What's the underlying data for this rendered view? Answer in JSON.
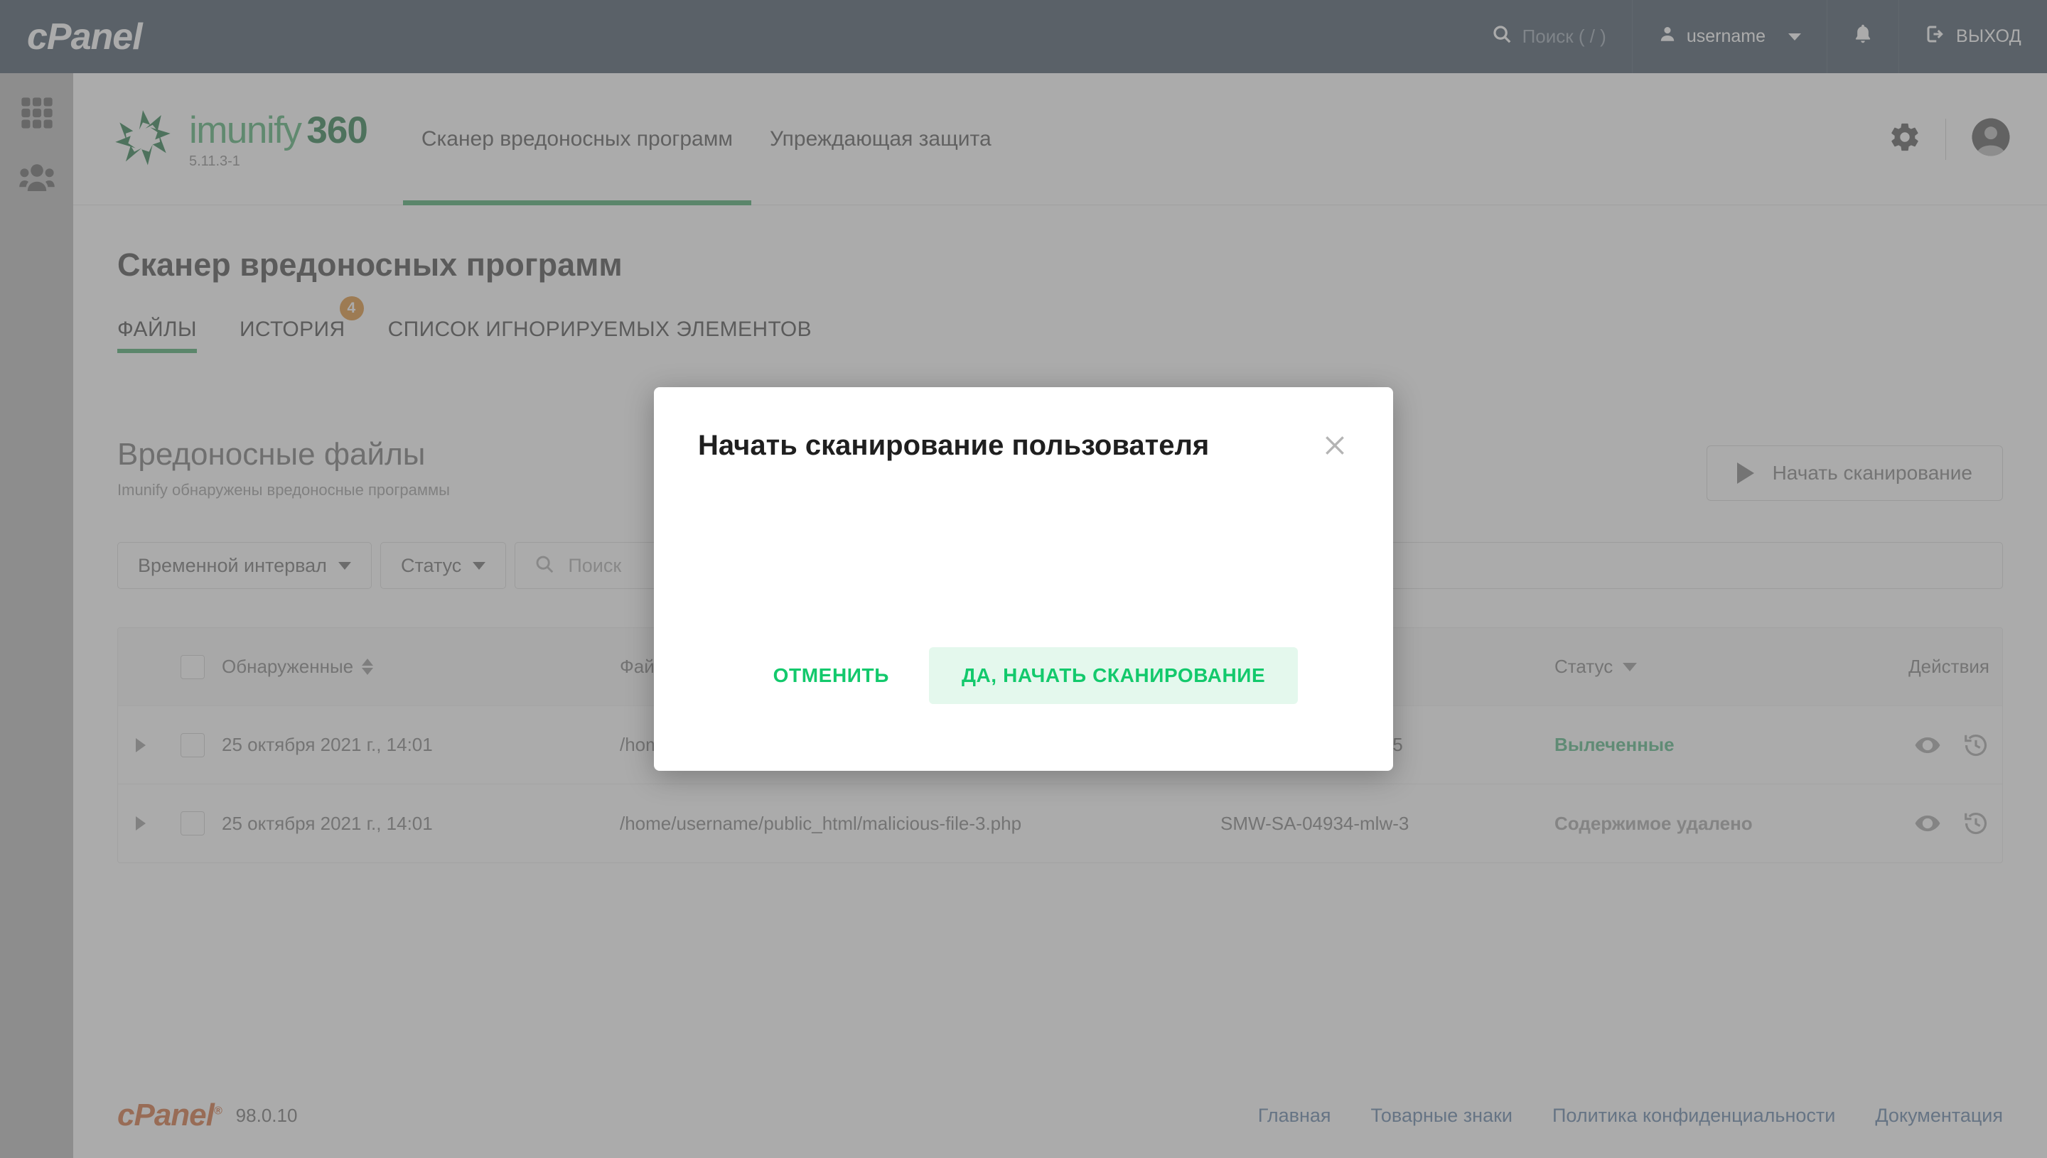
{
  "topbar": {
    "logo_text": "cPanel",
    "search_placeholder": "Поиск ( / )",
    "username": "username",
    "logout_label": "ВЫХОД"
  },
  "sidebar": {
    "items": [
      {
        "icon": "apps-grid-icon",
        "label": "Приложения"
      },
      {
        "icon": "users-icon",
        "label": "Пользователи"
      }
    ]
  },
  "imunify": {
    "brand_imunify": "imunify",
    "brand_360": "360",
    "version": "5.11.3-1",
    "nav": [
      {
        "label": "Сканер вредоносных программ",
        "active": true
      },
      {
        "label": "Упреждающая защита",
        "active": false
      }
    ]
  },
  "page": {
    "title": "Сканер вредоносных программ",
    "tabs": [
      {
        "label": "ФАЙЛЫ",
        "active": true,
        "badge": ""
      },
      {
        "label": "ИСТОРИЯ",
        "active": false,
        "badge": "4"
      },
      {
        "label": "СПИСОК ИГНОРИРУЕМЫХ ЭЛЕМЕНТОВ",
        "active": false,
        "badge": ""
      }
    ],
    "section_title": "Вредоносные файлы",
    "section_subtitle": "Imunify обнаружены вредоносные программы",
    "scan_button_label": "Начать сканирование"
  },
  "filters": {
    "timeframe_label": "Временной интервал",
    "status_label": "Статус",
    "search_placeholder": "Поиск"
  },
  "table": {
    "columns": {
      "detected": "Обнаруженные",
      "file": "Файл",
      "signature": "",
      "status": "Статус",
      "actions": "Действия"
    },
    "rows": [
      {
        "detected": "25 октября 2021 г., 14:01",
        "file": "/home/username/public_html/malicious-file-5.php",
        "signature": "SMW-SA-04934-bdr-5",
        "status": "Вылеченные",
        "status_kind": "cured"
      },
      {
        "detected": "25 октября 2021 г., 14:01",
        "file": "/home/username/public_html/malicious-file-3.php",
        "signature": "SMW-SA-04934-mlw-3",
        "status": "Содержимое удалено",
        "status_kind": "removed"
      }
    ]
  },
  "modal": {
    "title": "Начать сканирование пользователя",
    "cancel_label": "ОТМЕНИТЬ",
    "confirm_label": "ДА, НАЧАТЬ СКАНИРОВАНИЕ"
  },
  "footer": {
    "logo_text": "cPanel",
    "version": "98.0.10",
    "links": [
      "Главная",
      "Товарные знаки",
      "Политика конфиденциальности",
      "Документация"
    ]
  },
  "colors": {
    "topbar_bg": "#2b3e50",
    "accent_green": "#2e9e57",
    "button_green": "#13c96c",
    "badge_orange": "#d98019",
    "cpanel_orange": "#cd5b21",
    "link_blue": "#4a6f9a"
  }
}
